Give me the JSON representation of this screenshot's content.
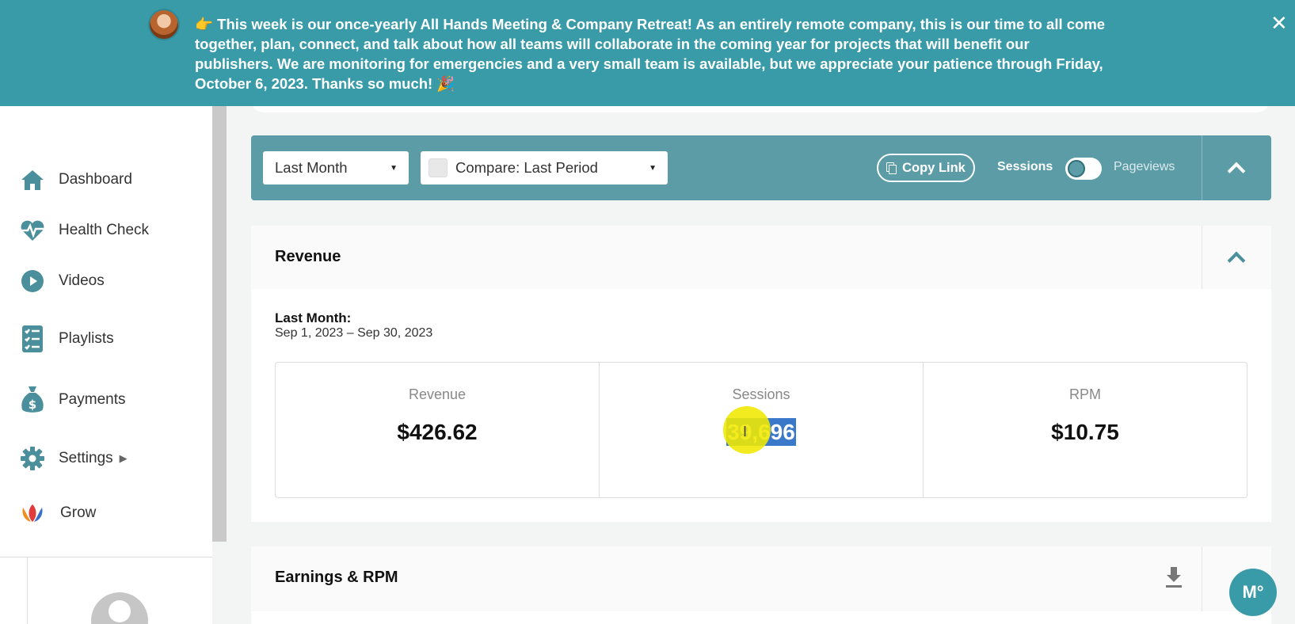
{
  "banner": {
    "message": "👉 This week is our once-yearly All Hands Meeting & Company Retreat! As an entirely remote company, this is our time to all come together, plan, connect, and talk about how all teams will collaborate in the coming year for projects that will benefit our publishers. We are monitoring for emergencies and a very small team is available, but we appreciate your patience through Friday, October 6, 2023. Thanks so much! 🎉",
    "close_label": "✕"
  },
  "sidebar": {
    "items": [
      {
        "label": "Dashboard",
        "icon": "home-icon"
      },
      {
        "label": "Health Check",
        "icon": "heartbeat-icon"
      },
      {
        "label": "Videos",
        "icon": "play-icon"
      },
      {
        "label": "Playlists",
        "icon": "list-icon"
      },
      {
        "label": "Payments",
        "icon": "money-bag-icon"
      },
      {
        "label": "Settings",
        "icon": "gear-icon",
        "caret": "▶"
      },
      {
        "label": "Grow",
        "icon": "grow-logo-icon"
      }
    ]
  },
  "filters": {
    "period": "Last Month",
    "compare": "Compare: Last Period",
    "copy_link": "Copy Link",
    "toggle_left": "Sessions",
    "toggle_right": "Pageviews",
    "dropdown_arrow": "▼"
  },
  "revenue": {
    "title": "Revenue",
    "period_label": "Last Month:",
    "period_range": "Sep 1, 2023 – Sep 30, 2023",
    "stats": [
      {
        "label": "Revenue",
        "value": "$426.62"
      },
      {
        "label": "Sessions",
        "value": "39,696"
      },
      {
        "label": "RPM",
        "value": "$10.75"
      }
    ]
  },
  "earnings": {
    "title": "Earnings & RPM"
  },
  "chat": {
    "label": "M°"
  },
  "colors": {
    "banner": "#3a9ba8",
    "filterbar": "#5b9ca7",
    "icon": "#4a8f9b"
  }
}
